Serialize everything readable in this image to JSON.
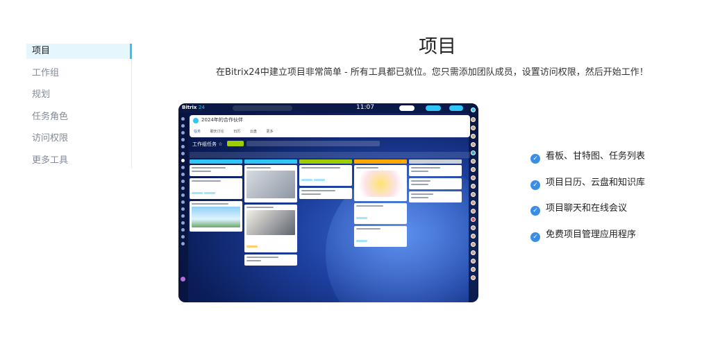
{
  "sidebar": {
    "items": [
      {
        "label": "项目",
        "active": true
      },
      {
        "label": "工作组"
      },
      {
        "label": "规划"
      },
      {
        "label": "任务角色"
      },
      {
        "label": "访问权限"
      },
      {
        "label": "更多工具"
      }
    ]
  },
  "header": {
    "title": "项目",
    "subtitle": "在Bitrix24中建立项目非常简单 - 所有工具都已就位。您只需添加团队成员，设置访问权限，然后开始工作！"
  },
  "screenshot": {
    "brand": "Bitrix",
    "brand_num": "24",
    "clock": "11:07",
    "project_name": "2024年的合作伙伴",
    "tabs": [
      "任务",
      "聊天讨论",
      "日历",
      "云盘",
      "更多"
    ],
    "group_title": "工作组任务 ☆",
    "colors": {
      "accent": "#2fc6f6",
      "green": "#9dcf00",
      "orange": "#ffa900",
      "col_blue": "#2fc6f6",
      "col_green": "#9dcf00",
      "col_orange": "#ffa900"
    }
  },
  "features": [
    {
      "icon": "check-icon",
      "label": "看板、甘特图、任务列表"
    },
    {
      "icon": "check-icon",
      "label": "项目日历、云盘和知识库"
    },
    {
      "icon": "check-icon",
      "label": "项目聊天和在线会议"
    },
    {
      "icon": "check-icon",
      "label": "免费项目管理应用程序"
    }
  ]
}
